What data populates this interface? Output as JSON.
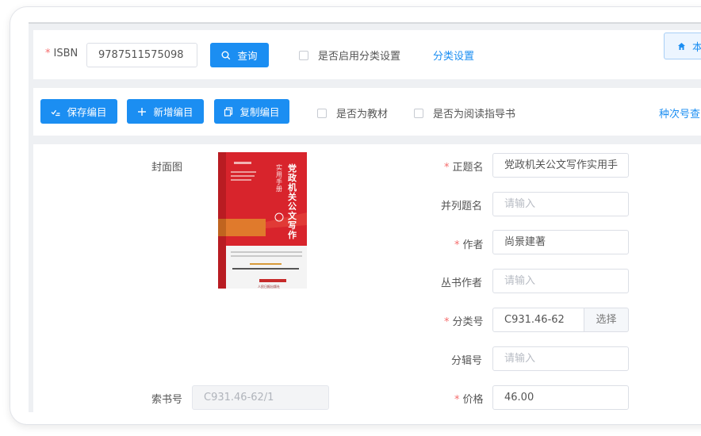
{
  "search": {
    "isbn_label": "ISBN",
    "isbn_value": "9787511575098",
    "query_label": "查询",
    "enable_classification_label": "是否启用分类设置",
    "classification_settings_link": "分类设置",
    "home_button_label": "本"
  },
  "toolbar": {
    "save_label": "保存编目",
    "new_label": "新增编目",
    "copy_label": "复制编目",
    "textbook_label": "是否为教材",
    "reading_guide_label": "是否为阅读指导书",
    "series_number_link": "种次号查"
  },
  "form": {
    "cover_label": "封面图",
    "call_number_label": "索书号",
    "call_number_value": "C931.46-62/1",
    "title_label": "正题名",
    "title_value": "党政机关公文写作实用手",
    "parallel_title_label": "并列题名",
    "parallel_title_placeholder": "请输入",
    "author_label": "作者",
    "author_value": "尚景建著",
    "series_author_label": "丛书作者",
    "series_author_placeholder": "请输入",
    "classification_label": "分类号",
    "classification_value": "C931.46-62",
    "select_label": "选择",
    "volume_label": "分辑号",
    "volume_placeholder": "请输入",
    "price_label": "价格",
    "price_value": "46.00"
  },
  "book_cover": {
    "title_line1": "党政机关公文写作",
    "title_line2": "实用手册",
    "publisher": "人民日报出版社"
  },
  "colors": {
    "primary": "#1b8ef2",
    "required": "#f56c6c",
    "cover_red": "#d8242c",
    "cover_orange": "#e07a2c"
  }
}
